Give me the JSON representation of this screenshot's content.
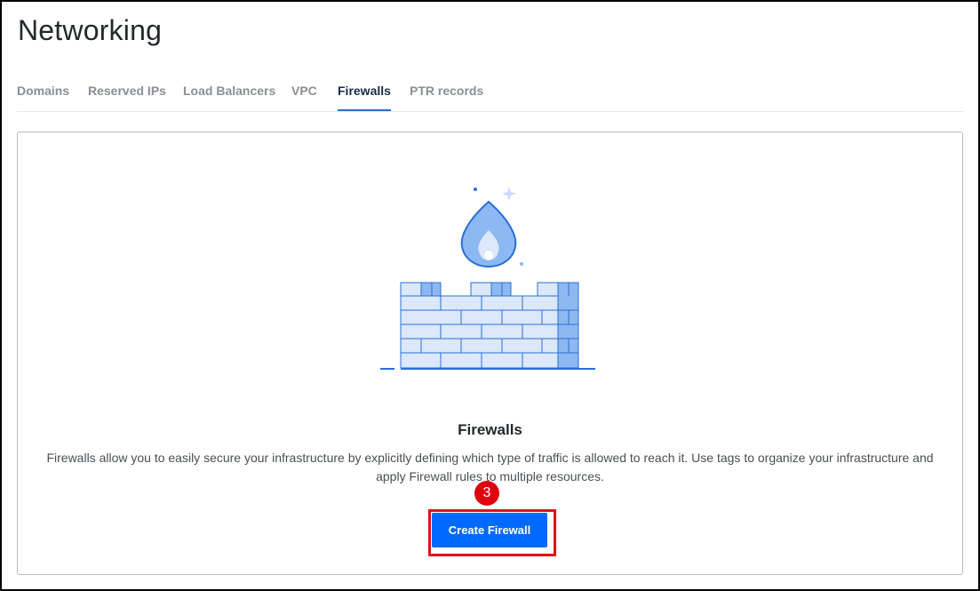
{
  "page": {
    "title": "Networking"
  },
  "tabs": [
    {
      "label": "Domains",
      "active": false
    },
    {
      "label": "Reserved IPs",
      "active": false
    },
    {
      "label": "Load Balancers",
      "active": false
    },
    {
      "label": "VPC",
      "active": false
    },
    {
      "label": "Firewalls",
      "active": true
    },
    {
      "label": "PTR records",
      "active": false
    }
  ],
  "empty_state": {
    "illustration_icon": "firewall-illustration-icon",
    "title": "Firewalls",
    "description": "Firewalls allow you to easily secure your infrastructure by explicitly defining which type of traffic is allowed to reach it. Use tags to organize your infrastructure and apply Firewall rules to multiple resources.",
    "create_button_label": "Create Firewall"
  },
  "step_badge": {
    "number": "3"
  },
  "colors": {
    "accent": "#0069ff",
    "highlight": "#e01018",
    "badge": "#e0000f",
    "illustration_light": "#dce8fb",
    "illustration_mid": "#8db8f2",
    "illustration_stroke": "#2a6fd6"
  }
}
